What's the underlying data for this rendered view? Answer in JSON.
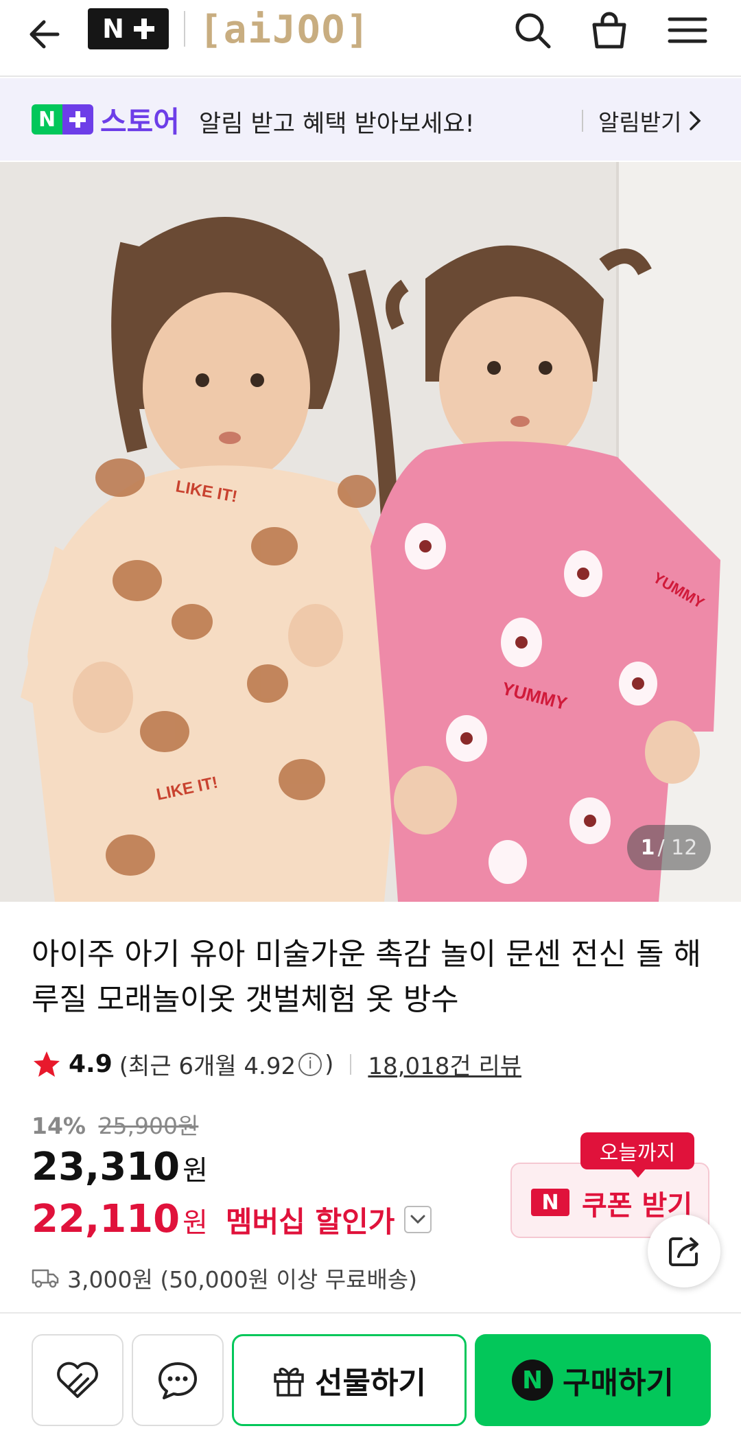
{
  "header": {
    "back_icon": "arrow-left-icon",
    "nplus_logo_text": "N",
    "brand_logo": "[aiJOO]",
    "icons": [
      "search-icon",
      "shopping-bag-icon",
      "menu-icon"
    ]
  },
  "notice": {
    "store_logo_text": "N",
    "store_name": "스토어",
    "message": "알림 받고 혜택 받아보세요!",
    "action": "알림받기",
    "action_icon": "chevron-right-icon"
  },
  "gallery": {
    "current": "1",
    "total": "/ 12",
    "print_texts": [
      "LIKE IT!",
      "YUMMY"
    ]
  },
  "product": {
    "title": "아이주 아기 유아 미술가운 촉감 놀이 문센 전신 돌 해루질 모래놀이옷 갯벌체험 옷 방수",
    "rating": "4.9",
    "recent_rating_prefix": "(최근 6개월 4.92",
    "recent_rating_suffix": ")",
    "review_count": "18,018건 리뷰",
    "discount_percent": "14%",
    "original_price": "25,900원",
    "price": "23,310",
    "price_unit": "원",
    "member_price": "22,110",
    "member_price_unit": "원",
    "member_label": "멤버십 할인가",
    "coupon_tag": "오늘까지",
    "coupon_badge": "N",
    "coupon_label": "쿠폰 받기",
    "shipping": "3,000원 (50,000원 이상 무료배송)"
  },
  "bottom_bar": {
    "gift_label": "선물하기",
    "buy_badge": "N",
    "buy_label": "구매하기"
  },
  "colors": {
    "naver_green": "#03c75a",
    "naver_purple": "#6d3ee8",
    "sale_red": "#e0123b",
    "banner_bg": "#f2f1fb"
  }
}
